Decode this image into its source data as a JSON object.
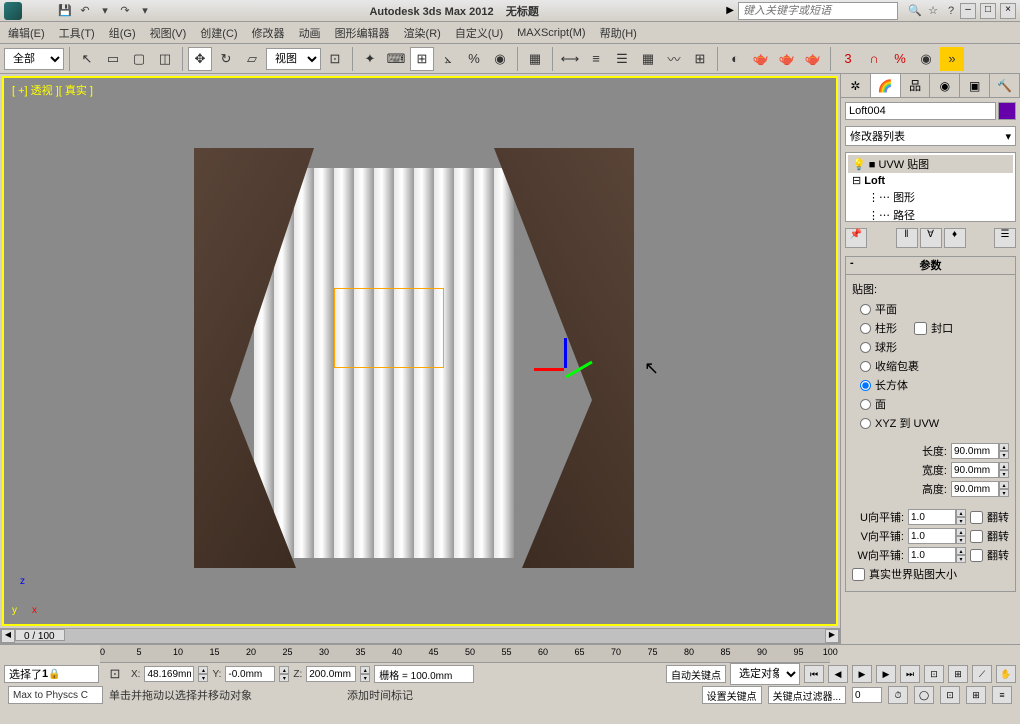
{
  "app": {
    "title": "Autodesk 3ds Max 2012",
    "doc_title": "无标题",
    "search_placeholder": "键入关键字或短语"
  },
  "quick": [
    "save-icon",
    "undo-icon",
    "undo-dd",
    "redo-icon",
    "redo-dd"
  ],
  "menubar": [
    {
      "k": "E",
      "label": "编辑(E)"
    },
    {
      "k": "T",
      "label": "工具(T)"
    },
    {
      "k": "G",
      "label": "组(G)"
    },
    {
      "k": "V",
      "label": "视图(V)"
    },
    {
      "k": "C",
      "label": "创建(C)"
    },
    {
      "k": "M",
      "label": "修改器"
    },
    {
      "k": "A",
      "label": "动画"
    },
    {
      "k": "G2",
      "label": "图形编辑器"
    },
    {
      "k": "R",
      "label": "渲染(R)"
    },
    {
      "k": "CU",
      "label": "自定义(U)"
    },
    {
      "k": "MX",
      "label": "MAXScript(M)"
    },
    {
      "k": "H",
      "label": "帮助(H)"
    }
  ],
  "toolbar": {
    "filter_dropdown": "全部",
    "ref_coord_dropdown": "视图"
  },
  "viewport": {
    "label": "[ +] 透视 ][ 真实 ]",
    "scrollbar_label": "0 / 100"
  },
  "command_panel": {
    "object_name": "Loft004",
    "modifier_dropdown": "修改器列表",
    "stack": {
      "active": "UVW 贴图",
      "items": [
        "Loft",
        "图形",
        "路径"
      ]
    },
    "rollout_params_title": "参数",
    "map_group": "贴图:",
    "map_types": [
      "平面",
      "柱形",
      "球形",
      "收缩包裹",
      "长方体",
      "面",
      "XYZ 到 UVW"
    ],
    "map_selected": "长方体",
    "cap_label": "封口",
    "length_label": "长度:",
    "length_val": "90.0mm",
    "width_label": "宽度:",
    "width_val": "90.0mm",
    "height_label": "高度:",
    "height_val": "90.0mm",
    "u_tile_label": "U向平铺:",
    "u_tile_val": "1.0",
    "v_tile_label": "V向平铺:",
    "v_tile_val": "1.0",
    "w_tile_label": "W向平铺:",
    "w_tile_val": "1.0",
    "flip_label": "翻转",
    "realworld_label": "真实世界贴图大小"
  },
  "timeline": {
    "ticks": [
      "0",
      "5",
      "10",
      "15",
      "20",
      "25",
      "30",
      "35",
      "40",
      "45",
      "50",
      "55",
      "60",
      "65",
      "70",
      "75",
      "80",
      "85",
      "90",
      "95",
      "100"
    ]
  },
  "status": {
    "selected_count": "选择了",
    "selected_icon": "1",
    "x_label": "X:",
    "x_val": "48.169mm",
    "y_label": "Y:",
    "y_val": "-0.0mm",
    "z_label": "Z:",
    "z_val": "200.0mm",
    "grid_label": "栅格 = 100.0mm",
    "auto_key": "自动关键点",
    "selected_obj": "选定对象",
    "set_key": "设置关键点",
    "key_filters": "关键点过滤器...",
    "max_physics": "Max to Physcs C",
    "status_hint": "单击并拖动以选择并移动对象",
    "add_time_tag": "添加时间标记"
  }
}
